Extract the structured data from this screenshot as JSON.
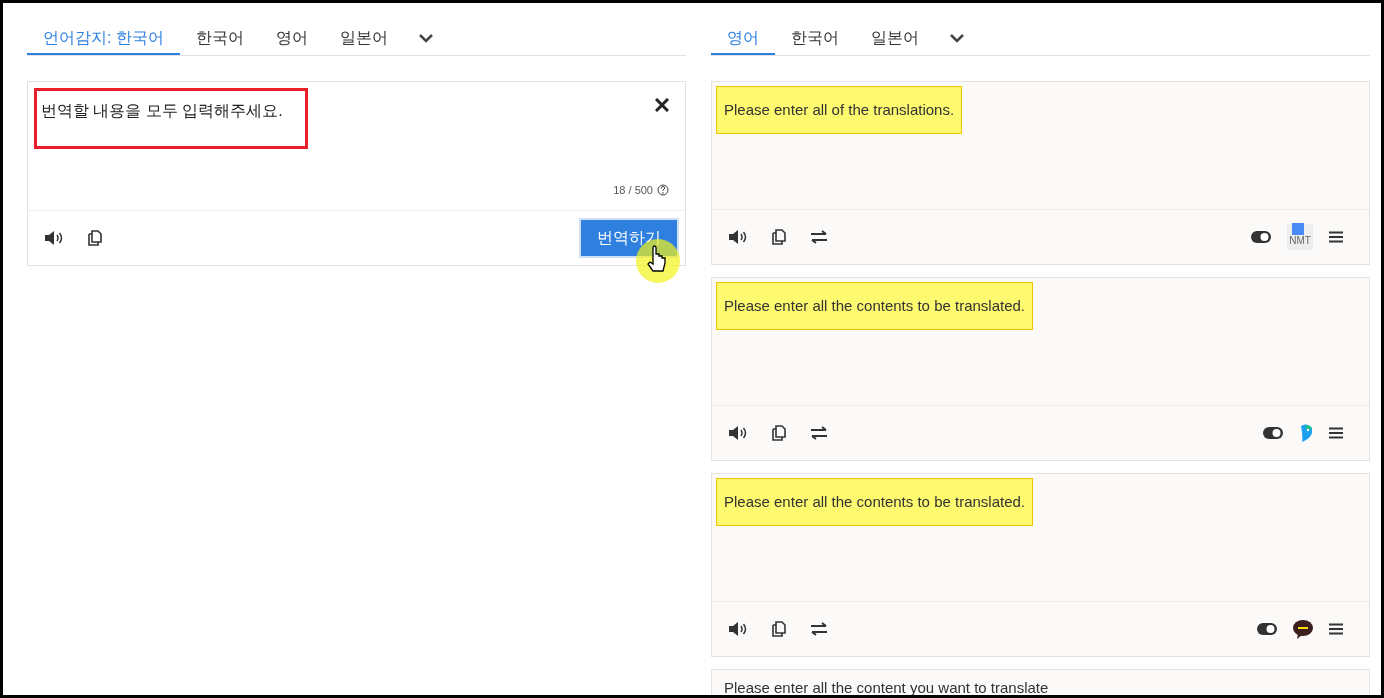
{
  "source": {
    "tabs": [
      {
        "label": "언어감지: 한국어",
        "selected": true
      },
      {
        "label": "한국어",
        "selected": false
      },
      {
        "label": "영어",
        "selected": false
      },
      {
        "label": "일본어",
        "selected": false
      }
    ],
    "input": {
      "value": "번역할 내용을 모두 입력해주세요.",
      "annotated": true
    },
    "counter": "18 / 500",
    "translate_button": "번역하기"
  },
  "target": {
    "tabs": [
      {
        "label": "영어",
        "selected": true
      },
      {
        "label": "한국어",
        "selected": false
      },
      {
        "label": "일본어",
        "selected": false
      }
    ],
    "results": [
      {
        "text": "Please enter all of the translations.",
        "highlighted": true,
        "kind": "google",
        "engine_label": "NMT"
      },
      {
        "text": "Please enter all the contents to be translated.",
        "highlighted": true,
        "kind": "papago"
      },
      {
        "text": "Please enter all the contents to be translated.",
        "highlighted": true,
        "kind": "kakao"
      },
      {
        "text": "Please enter all the content you want to translate",
        "highlighted": false
      }
    ]
  }
}
